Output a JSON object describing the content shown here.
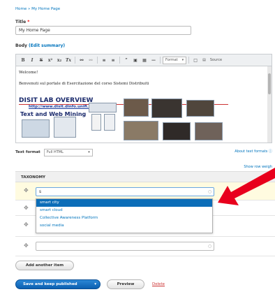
{
  "breadcrumb": "Home » My Home Page",
  "title": {
    "label": "Title",
    "required_mark": "*",
    "value": "My Home Page"
  },
  "body": {
    "label": "Body",
    "edit_summary": "(Edit summary)"
  },
  "toolbar": {
    "format_label": "Format",
    "source_label": "Source",
    "buttons": [
      "B",
      "I",
      "S",
      "x²",
      "x₂",
      "Tx",
      "link",
      "unlink",
      "bullets",
      "numbers",
      "quote",
      "image",
      "table",
      "hr"
    ]
  },
  "editor": {
    "welcome": "Welcome!",
    "intro": "Benvenuti sul portale di Esercitazione del corso Sistemi Distribuiti",
    "banner_title": "DISIT LAB OVERVIEW",
    "banner_url": "http://www.disit.dinfo.unifi.it",
    "banner_subtitle": "Text and Web Mining"
  },
  "text_format": {
    "label": "Text format",
    "value": "Full HTML",
    "about": "About text formats"
  },
  "taxonomy": {
    "show_weights": "Show row weigh",
    "header": "TAXONOMY",
    "input_value": "s",
    "suggestions": [
      "smart city",
      "smart cloud",
      "Collective Awareness Platform",
      "social media"
    ],
    "add_another": "Add another item"
  },
  "actions": {
    "save": "Save and keep published",
    "preview": "Preview",
    "delete": "Delete"
  },
  "colors": {
    "accent": "#0074bd",
    "annotation_arrow": "#e8001c"
  }
}
